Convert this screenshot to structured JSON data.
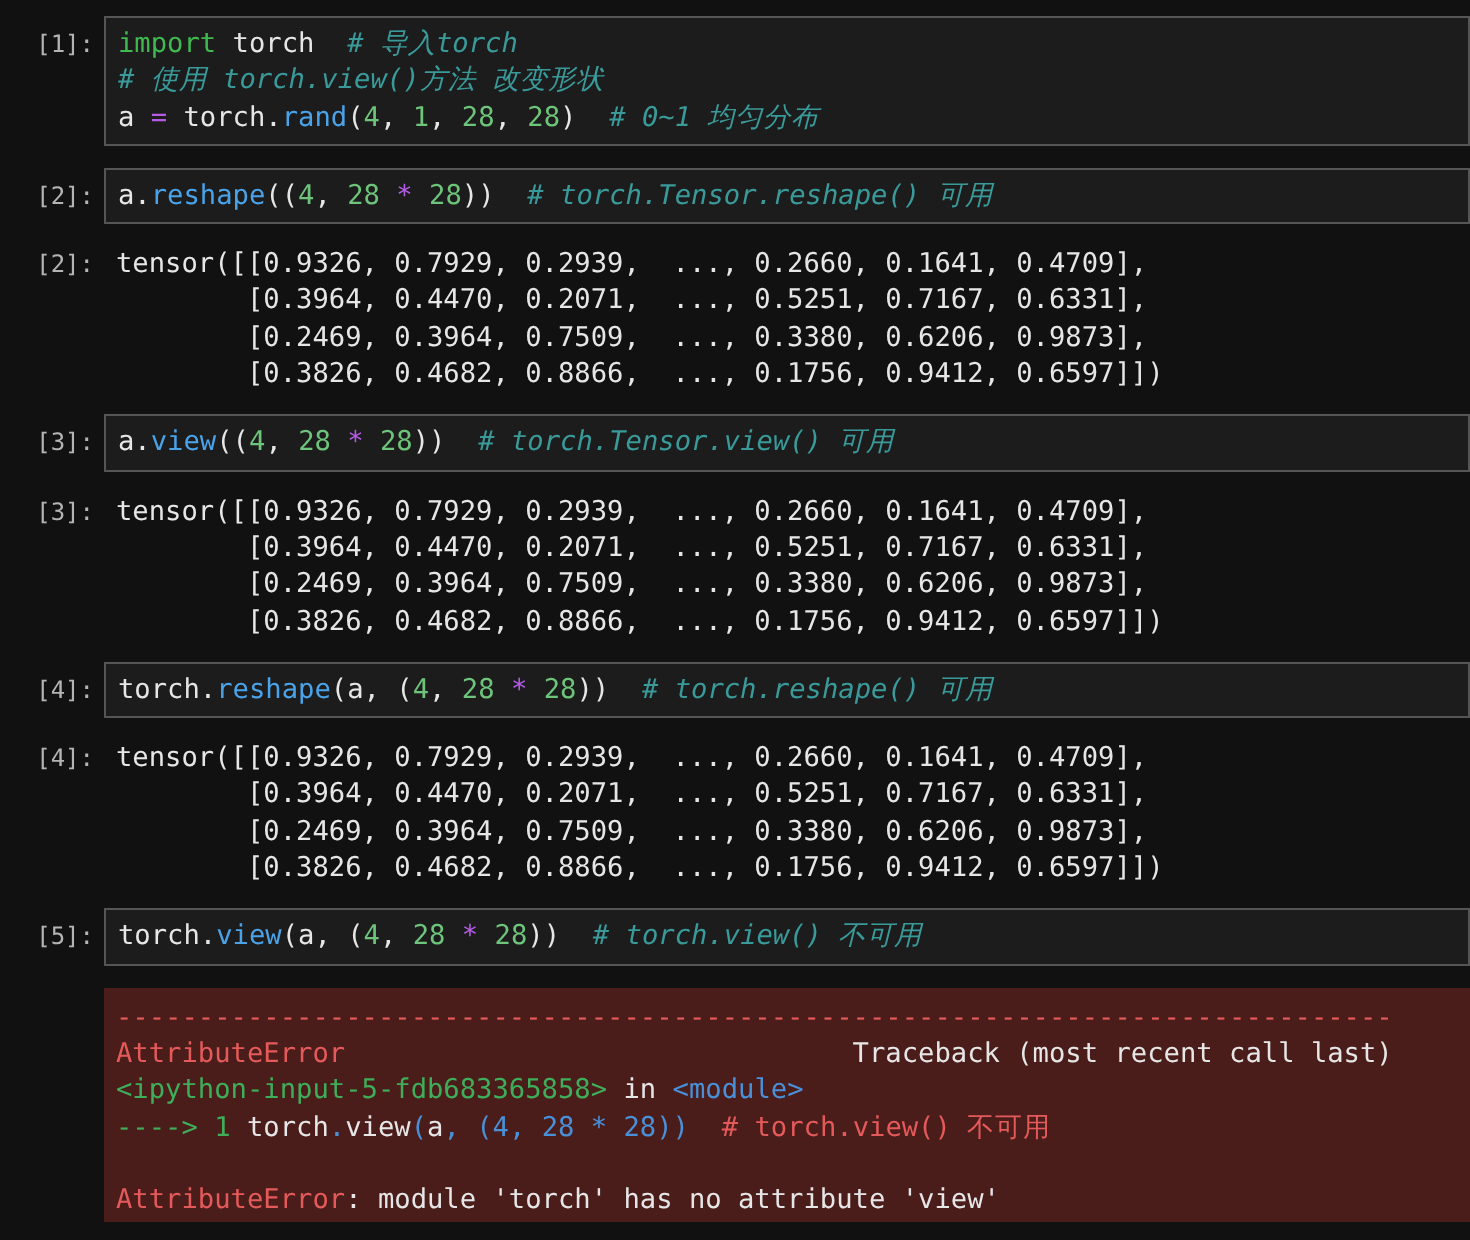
{
  "cells": [
    {
      "kind": "code",
      "prompt": "[1]:",
      "lines": [
        [
          {
            "t": "import",
            "kind": "keyword"
          },
          {
            "t": " torch  ",
            "kind": "text"
          },
          {
            "t": "# 导入torch",
            "kind": "comment"
          }
        ],
        [
          {
            "t": "# 使用 torch.view()方法 改变形状",
            "kind": "comment"
          }
        ],
        [
          {
            "t": "a ",
            "kind": "text"
          },
          {
            "t": "=",
            "kind": "operator"
          },
          {
            "t": " torch.",
            "kind": "text"
          },
          {
            "t": "rand",
            "kind": "function"
          },
          {
            "t": "(",
            "kind": "text"
          },
          {
            "t": "4",
            "kind": "number"
          },
          {
            "t": ", ",
            "kind": "text"
          },
          {
            "t": "1",
            "kind": "number"
          },
          {
            "t": ", ",
            "kind": "text"
          },
          {
            "t": "28",
            "kind": "number"
          },
          {
            "t": ", ",
            "kind": "text"
          },
          {
            "t": "28",
            "kind": "number"
          },
          {
            "t": ")  ",
            "kind": "text"
          },
          {
            "t": "# 0~1 均匀分布",
            "kind": "comment"
          }
        ]
      ]
    },
    {
      "kind": "code",
      "prompt": "[2]:",
      "lines": [
        [
          {
            "t": "a.",
            "kind": "text"
          },
          {
            "t": "reshape",
            "kind": "function"
          },
          {
            "t": "((",
            "kind": "text"
          },
          {
            "t": "4",
            "kind": "number"
          },
          {
            "t": ", ",
            "kind": "text"
          },
          {
            "t": "28",
            "kind": "number"
          },
          {
            "t": " * ",
            "kind": "operator"
          },
          {
            "t": "28",
            "kind": "number"
          },
          {
            "t": "))  ",
            "kind": "text"
          },
          {
            "t": "# torch.Tensor.reshape() 可用",
            "kind": "comment"
          }
        ]
      ]
    },
    {
      "kind": "output",
      "prompt": "[2]:",
      "lines": [
        "tensor([[0.9326, 0.7929, 0.2939,  ..., 0.2660, 0.1641, 0.4709],",
        "        [0.3964, 0.4470, 0.2071,  ..., 0.5251, 0.7167, 0.6331],",
        "        [0.2469, 0.3964, 0.7509,  ..., 0.3380, 0.6206, 0.9873],",
        "        [0.3826, 0.4682, 0.8866,  ..., 0.1756, 0.9412, 0.6597]])"
      ]
    },
    {
      "kind": "code",
      "prompt": "[3]:",
      "lines": [
        [
          {
            "t": "a.",
            "kind": "text"
          },
          {
            "t": "view",
            "kind": "function"
          },
          {
            "t": "((",
            "kind": "text"
          },
          {
            "t": "4",
            "kind": "number"
          },
          {
            "t": ", ",
            "kind": "text"
          },
          {
            "t": "28",
            "kind": "number"
          },
          {
            "t": " * ",
            "kind": "operator"
          },
          {
            "t": "28",
            "kind": "number"
          },
          {
            "t": "))  ",
            "kind": "text"
          },
          {
            "t": "# torch.Tensor.view() 可用",
            "kind": "comment"
          }
        ]
      ]
    },
    {
      "kind": "output",
      "prompt": "[3]:",
      "lines": [
        "tensor([[0.9326, 0.7929, 0.2939,  ..., 0.2660, 0.1641, 0.4709],",
        "        [0.3964, 0.4470, 0.2071,  ..., 0.5251, 0.7167, 0.6331],",
        "        [0.2469, 0.3964, 0.7509,  ..., 0.3380, 0.6206, 0.9873],",
        "        [0.3826, 0.4682, 0.8866,  ..., 0.1756, 0.9412, 0.6597]])"
      ]
    },
    {
      "kind": "code",
      "prompt": "[4]:",
      "lines": [
        [
          {
            "t": "torch.",
            "kind": "text"
          },
          {
            "t": "reshape",
            "kind": "function"
          },
          {
            "t": "(a, (",
            "kind": "text"
          },
          {
            "t": "4",
            "kind": "number"
          },
          {
            "t": ", ",
            "kind": "text"
          },
          {
            "t": "28",
            "kind": "number"
          },
          {
            "t": " * ",
            "kind": "operator"
          },
          {
            "t": "28",
            "kind": "number"
          },
          {
            "t": "))  ",
            "kind": "text"
          },
          {
            "t": "# torch.reshape() 可用",
            "kind": "comment"
          }
        ]
      ]
    },
    {
      "kind": "output",
      "prompt": "[4]:",
      "lines": [
        "tensor([[0.9326, 0.7929, 0.2939,  ..., 0.2660, 0.1641, 0.4709],",
        "        [0.3964, 0.4470, 0.2071,  ..., 0.5251, 0.7167, 0.6331],",
        "        [0.2469, 0.3964, 0.7509,  ..., 0.3380, 0.6206, 0.9873],",
        "        [0.3826, 0.4682, 0.8866,  ..., 0.1756, 0.9412, 0.6597]])"
      ]
    },
    {
      "kind": "code",
      "prompt": "[5]:",
      "lines": [
        [
          {
            "t": "torch.",
            "kind": "text"
          },
          {
            "t": "view",
            "kind": "function"
          },
          {
            "t": "(a, (",
            "kind": "text"
          },
          {
            "t": "4",
            "kind": "number"
          },
          {
            "t": ", ",
            "kind": "text"
          },
          {
            "t": "28",
            "kind": "number"
          },
          {
            "t": " * ",
            "kind": "operator"
          },
          {
            "t": "28",
            "kind": "number"
          },
          {
            "t": "))  ",
            "kind": "text"
          },
          {
            "t": "# torch.view() 不可用",
            "kind": "comment"
          }
        ]
      ]
    },
    {
      "kind": "error",
      "lines": [
        {
          "kind": "text",
          "tokens": [
            {
              "t": "------------------------------------------------------------------------------",
              "kind": "rule"
            }
          ]
        },
        {
          "kind": "text",
          "tokens": [
            {
              "t": "AttributeError",
              "kind": "ename"
            },
            {
              "t": "                               Traceback (most recent call last)",
              "kind": "text"
            }
          ]
        },
        {
          "kind": "text",
          "tokens": [
            {
              "t": "<ipython-input-5-fdb683365858>",
              "kind": "location"
            },
            {
              "t": " in ",
              "kind": "text"
            },
            {
              "t": "<module>",
              "kind": "module"
            }
          ]
        },
        {
          "kind": "text",
          "tokens": [
            {
              "t": "----> 1 ",
              "kind": "arrow"
            },
            {
              "t": "torch",
              "kind": "text"
            },
            {
              "t": ".",
              "kind": "module"
            },
            {
              "t": "view",
              "kind": "text"
            },
            {
              "t": "(",
              "kind": "module"
            },
            {
              "t": "a",
              "kind": "text"
            },
            {
              "t": ", (4, 28 * 28))",
              "kind": "module"
            },
            {
              "t": "  # torch.view() 不可用",
              "kind": "ename"
            }
          ]
        },
        {
          "kind": "blank"
        },
        {
          "kind": "text",
          "tokens": [
            {
              "t": "AttributeError",
              "kind": "ename"
            },
            {
              "t": ": module 'torch' has no attribute 'view'",
              "kind": "text"
            }
          ]
        }
      ]
    }
  ]
}
